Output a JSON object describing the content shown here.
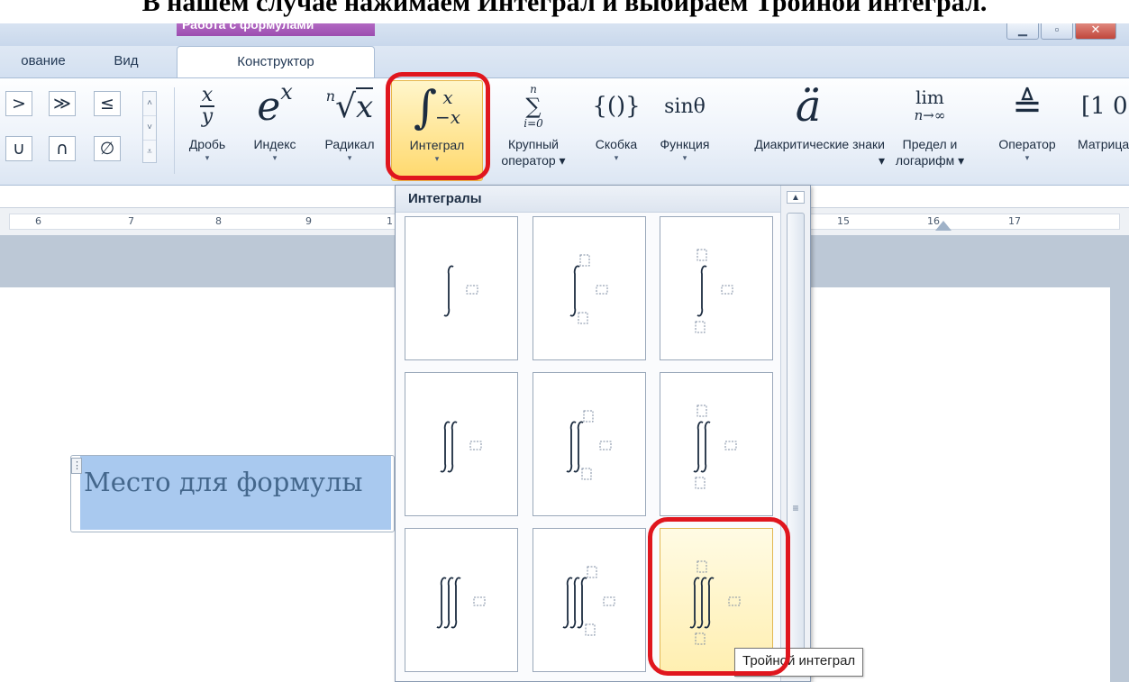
{
  "caption": "В нашем случае нажимаем Интеграл и выбираем Тройной интеграл.",
  "contextual_group": "Работа с формулами",
  "window_controls": [
    "▁",
    "▫",
    "✕"
  ],
  "tabs": {
    "review": "ование",
    "view": "Вид",
    "design": "Конструктор"
  },
  "symbols": [
    ">",
    "≫",
    "≤",
    "∪",
    "∩",
    "∅"
  ],
  "symbol_scroll": [
    "˄",
    "˅",
    "⩡"
  ],
  "ribbon": [
    {
      "id": "fraction",
      "label": "Дробь",
      "caret": "▾"
    },
    {
      "id": "script",
      "label": "Индекс",
      "caret": "▾"
    },
    {
      "id": "radical",
      "label": "Радикал",
      "caret": "▾"
    },
    {
      "id": "integral",
      "label": "Интеграл",
      "caret": "▾"
    },
    {
      "id": "large-operator",
      "label": "Крупный оператор ▾",
      "caret": ""
    },
    {
      "id": "bracket",
      "label": "Скобка",
      "caret": "▾"
    },
    {
      "id": "function",
      "label": "Функция",
      "caret": "▾"
    },
    {
      "id": "accent",
      "label": "Диакритические знаки ▾",
      "caret": ""
    },
    {
      "id": "limit",
      "label": "Предел и логарифм ▾",
      "caret": ""
    },
    {
      "id": "operator",
      "label": "Оператор",
      "caret": "▾"
    },
    {
      "id": "matrix",
      "label": "Матрица",
      "caret": ""
    }
  ],
  "glyphs": {
    "fraction_num": "x",
    "fraction_den": "y",
    "index_base": "e",
    "index_sup": "x",
    "radical_index": "n",
    "radical_sign": "√",
    "radical_base": "x",
    "integral_sign": "∫",
    "integral_upper": "x",
    "integral_lower": "−x",
    "sum_upper": "n",
    "sum_sign": "∑",
    "sum_lower": "i=0",
    "bracket": "{()}",
    "function": "sinθ",
    "accent": "ä",
    "limit_top": "lim",
    "limit_bottom": "n→∞",
    "operator": "≜",
    "matrix": "[1 0"
  },
  "ruler_numbers": [
    "6",
    "7",
    "8",
    "9",
    "1",
    "15",
    "16",
    "17"
  ],
  "gallery": {
    "header": "Интегралы",
    "scroll_up": "▲",
    "scroll_grip": "≡",
    "items": [
      {
        "name": "integral",
        "signs": 1,
        "limits": "none"
      },
      {
        "name": "integral-with-limits-subsup",
        "signs": 1,
        "limits": "subsup"
      },
      {
        "name": "integral-with-limits-above-below",
        "signs": 1,
        "limits": "stack"
      },
      {
        "name": "double-integral",
        "signs": 2,
        "limits": "none"
      },
      {
        "name": "double-integral-with-limits-subsup",
        "signs": 2,
        "limits": "subsup"
      },
      {
        "name": "double-integral-with-limits-above-below",
        "signs": 2,
        "limits": "stack"
      },
      {
        "name": "triple-integral",
        "signs": 3,
        "limits": "none"
      },
      {
        "name": "triple-integral-with-limits-subsup",
        "signs": 3,
        "limits": "subsup"
      },
      {
        "name": "triple-integral-with-limits-above-below",
        "signs": 3,
        "limits": "stack",
        "hover": true
      }
    ]
  },
  "tooltip": "Тройной интеграл",
  "document": {
    "equation_placeholder": "Место для формулы",
    "handle": "⋮"
  },
  "colors": {
    "highlight": "#e0161e",
    "selection": "#a9c9ef",
    "context_tab": "#9c4db0"
  }
}
